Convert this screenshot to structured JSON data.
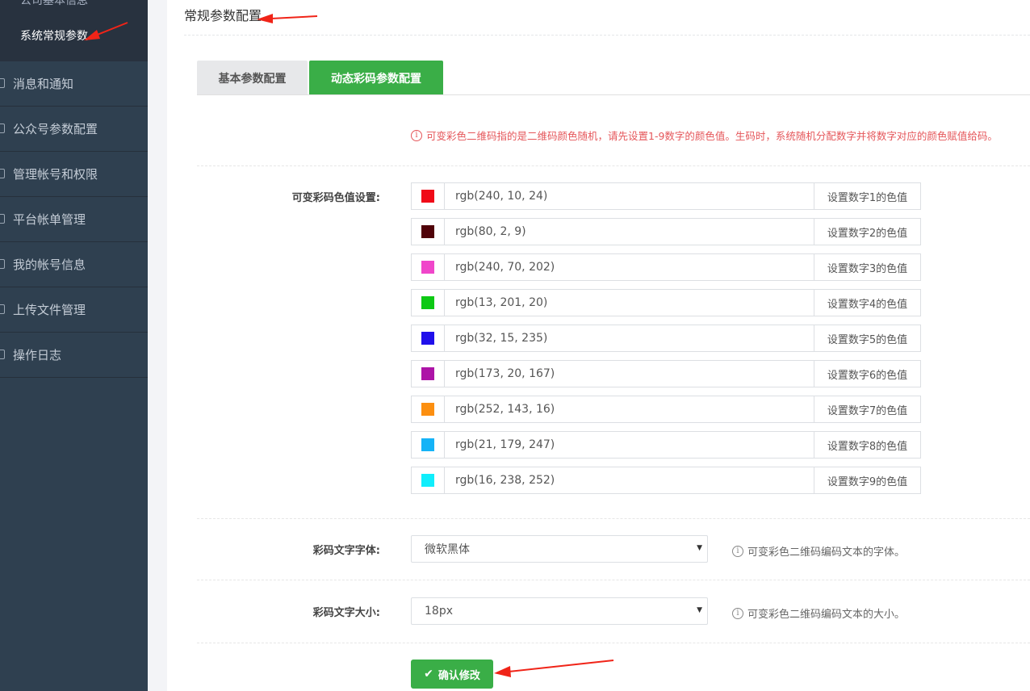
{
  "sidebar": {
    "prev_sub_item": "公司基本信息",
    "active_sub_item": "系统常规参数",
    "items": [
      {
        "label": "消息和通知",
        "icon": "message-icon"
      },
      {
        "label": "公众号参数配置",
        "icon": "wechat-icon"
      },
      {
        "label": "管理帐号和权限",
        "icon": "shield-icon"
      },
      {
        "label": "平台帐单管理",
        "icon": "bill-icon"
      },
      {
        "label": "我的帐号信息",
        "icon": "user-icon"
      },
      {
        "label": "上传文件管理",
        "icon": "upload-icon"
      },
      {
        "label": "操作日志",
        "icon": "log-icon"
      }
    ]
  },
  "page": {
    "title": "常规参数配置"
  },
  "tabs": [
    {
      "label": "基本参数配置",
      "active": false
    },
    {
      "label": "动态彩码参数配置",
      "active": true
    }
  ],
  "notice": "可变彩色二维码指的是二维码颜色随机，请先设置1-9数字的颜色值。生码时，系统随机分配数字并将数字对应的颜色赋值给码。",
  "color_settings": {
    "label": "可变彩码色值设置:",
    "rows": [
      {
        "value": "rgb(240, 10, 24)",
        "color": "#f00a18",
        "addon": "设置数字1的色值"
      },
      {
        "value": "rgb(80, 2, 9)",
        "color": "#500209",
        "addon": "设置数字2的色值"
      },
      {
        "value": "rgb(240, 70, 202)",
        "color": "#f046ca",
        "addon": "设置数字3的色值"
      },
      {
        "value": "rgb(13, 201, 20)",
        "color": "#0dc914",
        "addon": "设置数字4的色值"
      },
      {
        "value": "rgb(32, 15, 235)",
        "color": "#200feb",
        "addon": "设置数字5的色值"
      },
      {
        "value": "rgb(173, 20, 167)",
        "color": "#ad14a7",
        "addon": "设置数字6的色值"
      },
      {
        "value": "rgb(252, 143, 16)",
        "color": "#fc8f10",
        "addon": "设置数字7的色值"
      },
      {
        "value": "rgb(21, 179, 247)",
        "color": "#15b3f7",
        "addon": "设置数字8的色值"
      },
      {
        "value": "rgb(16, 238, 252)",
        "color": "#10eefc",
        "addon": "设置数字9的色值"
      }
    ]
  },
  "font_setting": {
    "label": "彩码文字字体:",
    "value": "微软黑体",
    "hint": "可变彩色二维码编码文本的字体。"
  },
  "size_setting": {
    "label": "彩码文字大小:",
    "value": "18px",
    "hint": "可变彩色二维码编码文本的大小。"
  },
  "submit": {
    "label": "确认修改"
  },
  "colors": {
    "accent_green": "#3aae47",
    "sidebar_bg": "#2f4050",
    "notice_red": "#e5565a",
    "annotation_red": "#f02418"
  }
}
